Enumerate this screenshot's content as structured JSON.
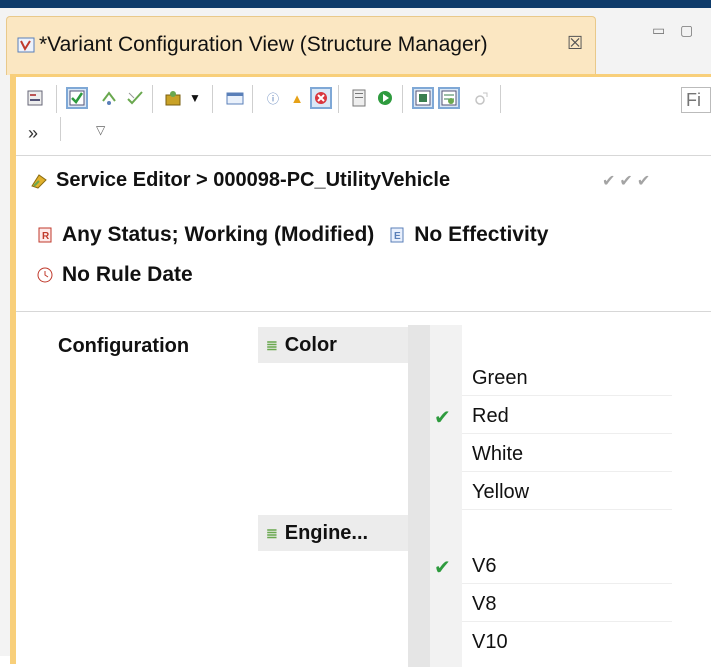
{
  "tab": {
    "title": "*Variant Configuration View (Structure Manager)",
    "close": "☒",
    "minimize": "▭",
    "maximize": "▢"
  },
  "toolbar": {
    "overflow": "»",
    "view_menu": "▽",
    "filter_placeholder": "Fi"
  },
  "header": {
    "breadcrumb": "Service Editor > 000098-PC_UtilityVehicle",
    "revision_rule": "Any Status; Working (Modified)",
    "effectivity": "No Effectivity",
    "rule_date": "No Rule Date"
  },
  "configuration": {
    "label": "Configuration",
    "families": [
      {
        "name": "Color",
        "options": [
          {
            "label": "Green",
            "selected": false
          },
          {
            "label": "Red",
            "selected": true
          },
          {
            "label": "White",
            "selected": false
          },
          {
            "label": "Yellow",
            "selected": false
          }
        ]
      },
      {
        "name": "Engine...",
        "options": [
          {
            "label": "V6",
            "selected": true
          },
          {
            "label": "V8",
            "selected": false
          },
          {
            "label": "V10",
            "selected": false
          }
        ]
      }
    ]
  },
  "colors": {
    "accent": "#f8cf7a",
    "check": "#2e9b3e",
    "title_bar": "#0e3b6a"
  }
}
